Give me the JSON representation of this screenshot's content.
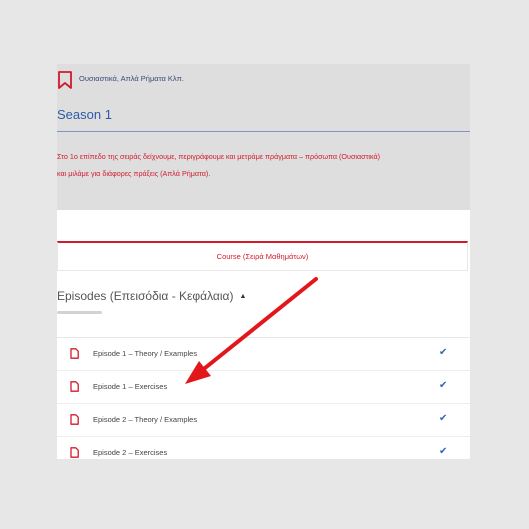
{
  "header": {
    "course_name": "Ουσιαστικά, Απλά Ρήματα Κλπ.",
    "season_title": "Season 1",
    "description_line1": "Στο 1ο επίπεδο της σειράς δείχνουμε, περιγράφουμε και μετράμε πράγματα – πρόσωπα (Ουσιαστικά)",
    "description_line2": "και μιλάμε για διάφορες πράξεις (Απλά Ρήματα).",
    "accent_color": "#d11b2c",
    "title_color": "#2f5aa8"
  },
  "course_tab": {
    "label": "Course (Σειρά Μαθημάτων)"
  },
  "episodes": {
    "heading": "Episodes (Επεισόδια - Κεφάλαια)",
    "caret": "▲",
    "items": [
      {
        "label": "Episode 1 – Theory / Examples",
        "icon": "file-icon",
        "status": "✔"
      },
      {
        "label": "Episode 1 – Exercises",
        "icon": "file-icon",
        "status": "✔"
      },
      {
        "label": "Episode 2 – Theory / Examples",
        "icon": "file-icon",
        "status": "✔"
      },
      {
        "label": "Episode 2 – Exercises",
        "icon": "file-icon",
        "status": "✔"
      }
    ]
  },
  "annotation": {
    "arrow_color": "#e3161b"
  }
}
